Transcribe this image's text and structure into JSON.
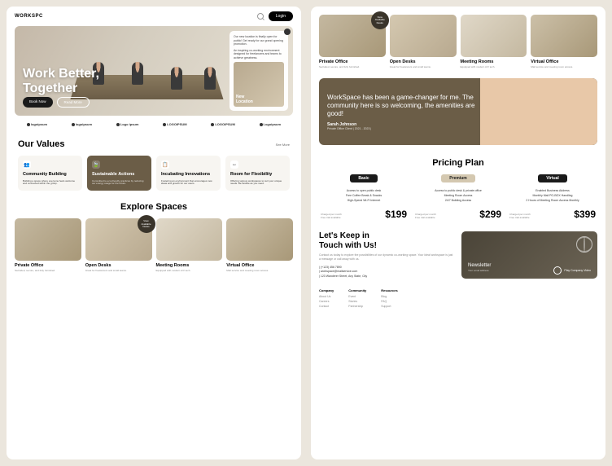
{
  "brand": "WORKSPC",
  "login": "Login",
  "hero": {
    "title1": "Work Better,",
    "title2": "Together",
    "book": "Book Now",
    "read": "Read More",
    "card_text": "Our new location is finally open for public! Get ready for our grand opening promotion.",
    "card_text2": "An inspiring co-working environment designed for freelancers and teams to achieve greatness.",
    "card_label1": "New",
    "card_label2": "Location"
  },
  "logos": [
    "logoipsum",
    "logoipsum",
    "Logo ipsum",
    "LOGOIPSUM",
    "LOGOIPSUM",
    "Logoipsum"
  ],
  "values": {
    "title": "Our Values",
    "see_more": "See More",
    "items": [
      {
        "icon": "👥",
        "title": "Community Building",
        "desc": "Building a space where everyone feels welcome and connected within the group."
      },
      {
        "icon": "🍃",
        "title": "Sustainable Actions",
        "desc": "Committed to eco-friendly practices by reducing our energy usage for the future."
      },
      {
        "icon": "📋",
        "title": "Incubating Innovations",
        "desc": "Fostering an environment that encourages new ideas and growth for our users."
      },
      {
        "icon": "↔",
        "title": "Room for Flexibility",
        "desc": "Offering various workspaces to suit your unique needs. Be flexible as you need."
      }
    ]
  },
  "explore": {
    "title": "Explore Spaces",
    "badge": "View Available Desks",
    "items": [
      {
        "name": "Private Office",
        "desc": "Secluded, secure, and fully furnished."
      },
      {
        "name": "Open Desks",
        "desc": "Great for freelancers and small teams."
      },
      {
        "name": "Meeting Rooms",
        "desc": "Equipped with modern A/V tech."
      },
      {
        "name": "Virtual Office",
        "desc": "Mail service and meeting room access."
      }
    ]
  },
  "testimonial": {
    "quote": "WorkSpace has been a game-changer for me. The community here is so welcoming, the amenities are good!",
    "name": "Sarah Johnson",
    "role": "Private Office Client | 2021 - 2023 |"
  },
  "pricing": {
    "title": "Pricing Plan",
    "meta1": "Charged per month",
    "meta2": "Free trial available",
    "plans": [
      {
        "name": "Basic",
        "price": "$199",
        "f1": "Access to open public desk",
        "f2": "Free Coffee Break & Snacks",
        "f3": "High-Speed Wi-Fi Internet"
      },
      {
        "name": "Premium",
        "price": "$299",
        "f1": "Access to public desk & private office",
        "f2": "Meeting Room Access",
        "f3": "24/7 Building Access"
      },
      {
        "name": "Virtual",
        "price": "$399",
        "f1": "Enabled Business Address",
        "f2": "Monthly Mail PO-BOX Handling",
        "f3": "2 Hours of Meeting Room Access Monthly"
      }
    ]
  },
  "contact": {
    "title1": "Let's Keep in",
    "title2": "Touch with Us!",
    "desc": "Contact us today to explore the possibilities of our dynamic co-working space. Your ideal workspace is just a message or call away with us.",
    "phone": "| (+123) 456 7890",
    "email": "| workspace@mailservice.com",
    "address": "| 123 Wanderer Street, Any State, City",
    "newsletter": "Newsletter",
    "newsletter_sub": "Your email address",
    "play": "Play Company Video"
  },
  "footer": {
    "cols": [
      {
        "head": "Company",
        "links": [
          "About Us",
          "Careers",
          "Contact"
        ]
      },
      {
        "head": "Community",
        "links": [
          "Event",
          "Stories",
          "Partnership"
        ]
      },
      {
        "head": "Resources",
        "links": [
          "Blog",
          "FAQ",
          "Support"
        ]
      }
    ]
  }
}
